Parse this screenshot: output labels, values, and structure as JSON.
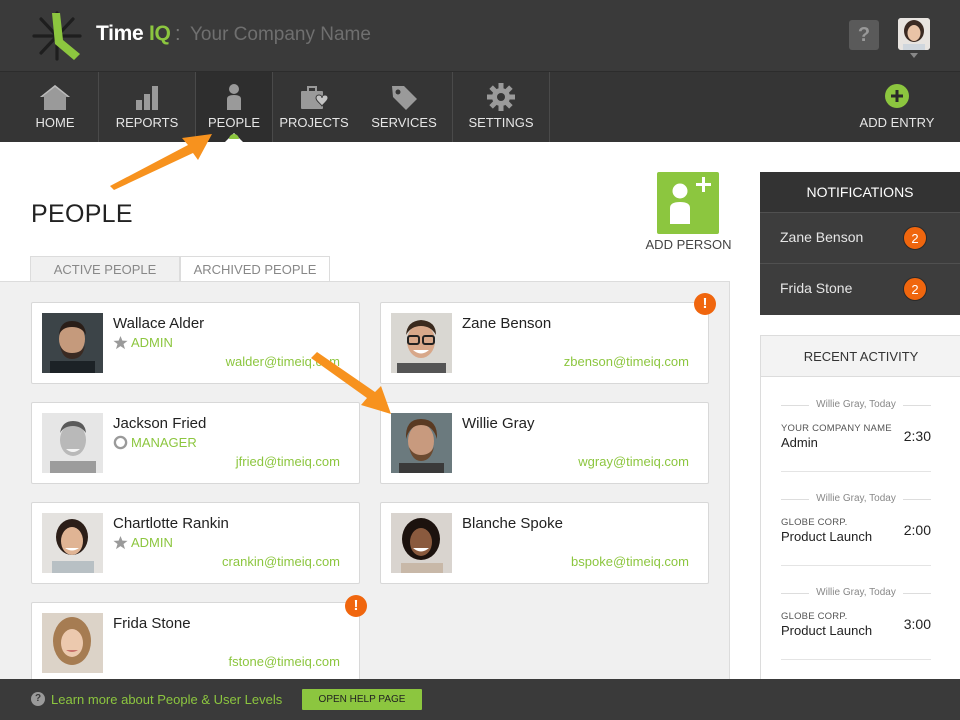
{
  "header": {
    "brand_time": "Time",
    "brand_iq": "IQ",
    "separator": ":",
    "company_placeholder": "Your Company Name",
    "help_label": "?"
  },
  "nav": {
    "items": [
      {
        "label": "HOME",
        "icon": "home-icon"
      },
      {
        "label": "REPORTS",
        "icon": "bar-chart-icon"
      },
      {
        "label": "PEOPLE",
        "icon": "person-icon",
        "active": true
      },
      {
        "label": "PROJECTS",
        "icon": "briefcase-heart-icon"
      },
      {
        "label": "SERVICES",
        "icon": "tag-icon"
      },
      {
        "label": "SETTINGS",
        "icon": "gear-icon"
      }
    ],
    "add_entry_label": "ADD ENTRY"
  },
  "page": {
    "title": "PEOPLE",
    "add_person_label": "ADD PERSON",
    "tabs": [
      {
        "label": "ACTIVE PEOPLE",
        "active": true
      },
      {
        "label": "ARCHIVED PEOPLE",
        "active": false
      }
    ]
  },
  "people": [
    {
      "name": "Wallace Alder",
      "role": "ADMIN",
      "role_icon": "star-icon",
      "email": "walder@timeiq.com",
      "alert": false
    },
    {
      "name": "Zane Benson",
      "role": "",
      "email": "zbenson@timeiq.com",
      "alert": true
    },
    {
      "name": "Jackson Fried",
      "role": "MANAGER",
      "role_icon": "circle-icon",
      "email": "jfried@timeiq.com",
      "alert": false
    },
    {
      "name": "Willie Gray",
      "role": "",
      "email": "wgray@timeiq.com",
      "alert": false
    },
    {
      "name": "Chartlotte Rankin",
      "role": "ADMIN",
      "role_icon": "star-icon",
      "email": "crankin@timeiq.com",
      "alert": false
    },
    {
      "name": "Blanche Spoke",
      "role": "",
      "email": "bspoke@timeiq.com",
      "alert": false
    },
    {
      "name": "Frida Stone",
      "role": "",
      "email": "fstone@timeiq.com",
      "alert": true
    }
  ],
  "alert_glyph": "!",
  "notifications": {
    "title": "NOTIFICATIONS",
    "items": [
      {
        "name": "Zane Benson",
        "count": "2"
      },
      {
        "name": "Frida Stone",
        "count": "2"
      }
    ]
  },
  "recent_activity": {
    "title": "RECENT ACTIVITY",
    "items": [
      {
        "when": "Willie Gray, Today",
        "client": "YOUR COMPANY NAME",
        "project": "Admin",
        "hours": "2:30"
      },
      {
        "when": "Willie Gray, Today",
        "client": "GLOBE CORP.",
        "project": "Product Launch",
        "hours": "2:00"
      },
      {
        "when": "Willie Gray, Today",
        "client": "GLOBE CORP.",
        "project": "Product Launch",
        "hours": "3:00"
      }
    ]
  },
  "footer": {
    "help_glyph": "?",
    "learn_text": "Learn more about People & User Levels",
    "open_help_label": "OPEN HELP PAGE"
  },
  "colors": {
    "accent_green": "#8cc63f",
    "alert_orange": "#f0660e",
    "topbar": "#3a3a3a",
    "nav": "#353535"
  }
}
